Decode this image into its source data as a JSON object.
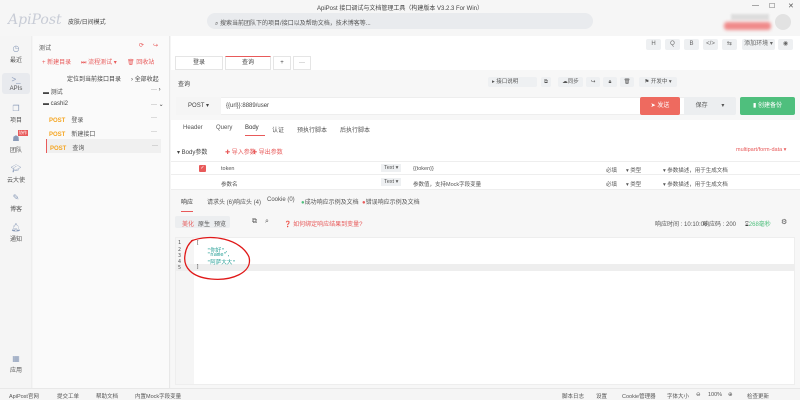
{
  "window": {
    "title": "ApiPost 接口调试与文档管理工具（构建版本 V3.2.3 For Win）",
    "logo": "ApiPost",
    "theme_toggle": "皮肤/日间模式",
    "search_placeholder": "搜索当前团队下的项目/接口以及帮助文档，技术博客等...",
    "min": "—",
    "max": "☐",
    "close": "✕"
  },
  "nav": [
    {
      "label": "最近",
      "icon": "clock-icon"
    },
    {
      "label": "APIs",
      "icon": "terminal-icon"
    },
    {
      "label": "项目",
      "icon": "project-icon"
    },
    {
      "label": "团队",
      "icon": "team-icon",
      "badge": "协作"
    },
    {
      "label": "云大使",
      "icon": "graduation-cap-icon"
    },
    {
      "label": "博客",
      "icon": "edit-icon"
    },
    {
      "label": "通知",
      "icon": "bell-icon"
    },
    {
      "label": "应用",
      "icon": "apps-icon"
    }
  ],
  "sidebar": {
    "project": "测试",
    "new_dir": "+ 新建目录",
    "flow_test": "流程测试 ▾",
    "recycle": "回收站",
    "locate": "定位到当前接口目录",
    "collapse": "› 全部收起",
    "tree": [
      {
        "type": "folder",
        "name": "测试"
      },
      {
        "type": "folder",
        "name": "cashi2"
      },
      {
        "type": "api",
        "method": "POST",
        "name": "登录"
      },
      {
        "type": "api",
        "method": "POST",
        "name": "新建接口"
      },
      {
        "type": "api",
        "method": "POST",
        "name": "查询",
        "active": true
      }
    ]
  },
  "toolbar": {
    "buttons": [
      "H",
      "Q",
      "B",
      "</>",
      "⇆"
    ],
    "env": "添加环境 ▾",
    "eye": "◉"
  },
  "tabs": [
    {
      "label": "登录"
    },
    {
      "label": "查询",
      "active": true
    },
    {
      "label": "+"
    },
    {
      "label": "···"
    }
  ],
  "request": {
    "name": "查询",
    "doc_btn": "▸ 接口说明",
    "sync": "同步",
    "status": "开发中 ▾",
    "method": "POST ▾",
    "url": "{{url}}:8889/user",
    "send": "发送",
    "save": "保存",
    "backup": "创建备份"
  },
  "subtabs": [
    "Header",
    "Query",
    "Body",
    "认证",
    "预执行脚本",
    "后执行脚本"
  ],
  "body": {
    "title": "▾ Body参数",
    "import": "导入参数",
    "export": "导出参数",
    "content_type": "multipart/form-data ▾",
    "rows": [
      {
        "key": "token",
        "type": "Text ▾",
        "value": "{{token}}",
        "required": "必填",
        "vtype": "类型",
        "desc": "参数描述，用于生成文档"
      },
      {
        "key": "参数名",
        "type": "Text ▾",
        "value": "参数值，支持Mock字段变量",
        "required": "必填",
        "vtype": "类型",
        "desc": "参数描述，用于生成文档"
      }
    ]
  },
  "response": {
    "tabs": [
      "响应",
      "请求头 (6)",
      "响应头 (4)",
      "Cookie (0)",
      "成功响应示例及文档",
      "错误响应示例及文档"
    ],
    "views": [
      "美化",
      "原生",
      "预览"
    ],
    "hint": "如何绑定响应结果到变量?",
    "time": "响应时间 : 10:10:06",
    "code": "响应码 : 200",
    "duration": "268毫秒",
    "lines": [
      "1",
      "2",
      "3",
      "4",
      "5"
    ],
    "code_lines": [
      "[",
      "\"你好\",",
      "\"name\",",
      "\"阿萨大大\"",
      "]"
    ]
  },
  "status": {
    "left": [
      "ApiPost官网",
      "提交工单",
      "帮助文档",
      "内置Mock字段变量"
    ],
    "right": [
      "脚本日志",
      "设置",
      "Cookie管理器",
      "字体大小",
      "100%",
      "检查更新"
    ]
  },
  "colors": {
    "accent": "#e85a5a",
    "send": "#ee6a5f",
    "backup": "#4fbf7d",
    "post": "#f5a623"
  }
}
